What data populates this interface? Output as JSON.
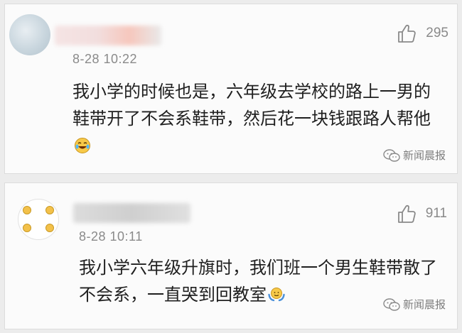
{
  "comments": [
    {
      "time": "8-28 10:22",
      "likes": "295",
      "text": "我小学的时候也是，六年级去学校的路上一男的鞋带开了不会系鞋带，然后花一块钱跟路人帮他",
      "emoji": "laughing-crying-icon",
      "watermark": "新闻晨报"
    },
    {
      "time": "8-28 10:11",
      "likes": "911",
      "text": "我小学六年级升旗时，我们班一个男生鞋带散了不会系，一直哭到回教室",
      "emoji": "shrug-icon",
      "watermark": "新闻晨报"
    }
  ],
  "colors": {
    "background": "#ececec",
    "card": "#fbfbfb",
    "text": "#1f1f1f",
    "meta": "#8a8a8a"
  }
}
